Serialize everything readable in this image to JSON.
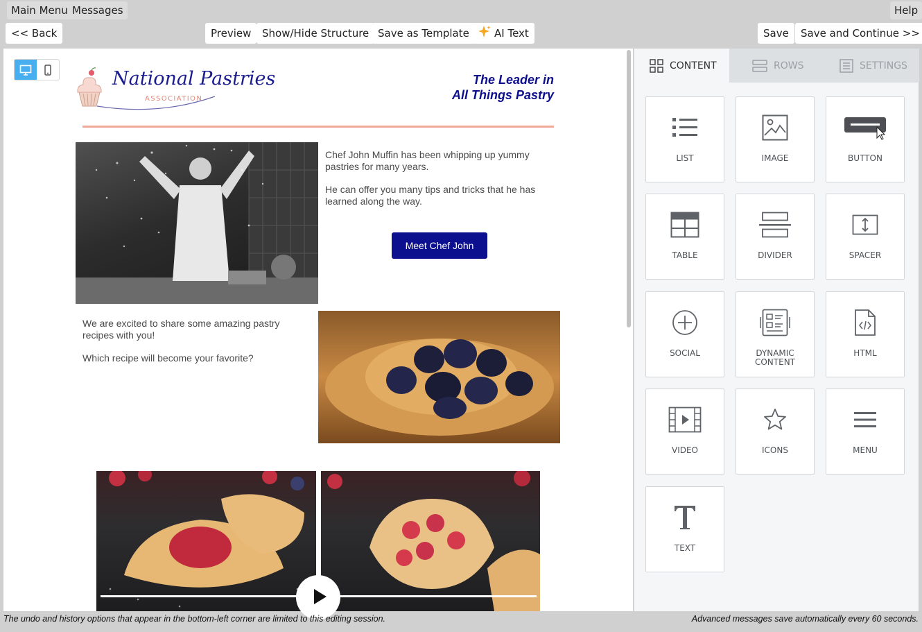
{
  "menu": {
    "main_menu": "Main Menu",
    "messages": "Messages",
    "help": "Help"
  },
  "toolbar": {
    "back": "<< Back",
    "preview": "Preview",
    "structure": "Show/Hide Structure",
    "save_template": "Save as Template",
    "ai_text": "AI Text",
    "save": "Save",
    "save_continue": "Save and Continue >>"
  },
  "email": {
    "logo_text": "National Pastries",
    "logo_sub": "ASSOCIATION",
    "headline_line1": "The Leader in",
    "headline_line2": "All Things Pastry",
    "block1_p1": "Chef John Muffin has been whipping up yummy pastries for many years.",
    "block1_p2": "He can offer you many tips and tricks that he has learned along the way.",
    "cta_label": "Meet Chef John",
    "block2_p1": "We are excited to share some amazing pastry recipes with you!",
    "block2_p2": "Which recipe will become your favorite?",
    "accent_color": "#0c0f8e",
    "divider_color": "#efa89a"
  },
  "panel": {
    "tabs": [
      {
        "label": "CONTENT",
        "icon": "grid-icon",
        "active": true
      },
      {
        "label": "ROWS",
        "icon": "rows-icon",
        "active": false
      },
      {
        "label": "SETTINGS",
        "icon": "settings-doc-icon",
        "active": false
      }
    ],
    "tiles": [
      {
        "label": "LIST",
        "icon": "list-icon"
      },
      {
        "label": "IMAGE",
        "icon": "image-icon"
      },
      {
        "label": "BUTTON",
        "icon": "button-icon"
      },
      {
        "label": "TABLE",
        "icon": "table-icon"
      },
      {
        "label": "DIVIDER",
        "icon": "divider-icon"
      },
      {
        "label": "SPACER",
        "icon": "spacer-icon"
      },
      {
        "label": "SOCIAL",
        "icon": "social-plus-icon"
      },
      {
        "label": "DYNAMIC CONTENT",
        "icon": "dynamic-content-icon"
      },
      {
        "label": "HTML",
        "icon": "html-file-icon"
      },
      {
        "label": "VIDEO",
        "icon": "video-icon"
      },
      {
        "label": "ICONS",
        "icon": "star-icon"
      },
      {
        "label": "MENU",
        "icon": "menu-icon"
      },
      {
        "label": "TEXT",
        "icon": "text-icon"
      }
    ]
  },
  "status": {
    "left": "The undo and history options that appear in the bottom-left corner are limited to this editing session.",
    "right": "Advanced messages save automatically every 60 seconds."
  }
}
